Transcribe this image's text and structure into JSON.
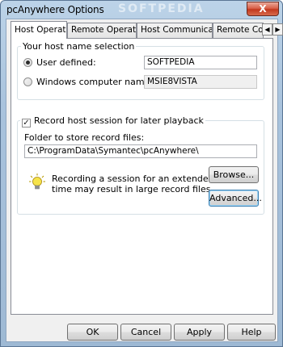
{
  "window": {
    "title": "pcAnywhere Options",
    "close_symbol": "X",
    "watermark": "SOFTPEDIA"
  },
  "tabs": [
    {
      "label": "Host Operation",
      "active": true
    },
    {
      "label": "Remote Operation",
      "active": false
    },
    {
      "label": "Host Communications",
      "active": false
    },
    {
      "label": "Remote Communications",
      "active": false
    }
  ],
  "tab_scroll": {
    "left_symbol": "◀",
    "right_symbol": "▶"
  },
  "host_name_group": {
    "legend": "Your host name selection",
    "user_defined": {
      "label": "User defined:",
      "checked": true,
      "value": "SOFTPEDIA"
    },
    "computer_name": {
      "label": "Windows computer name:",
      "checked": false,
      "value": "MSIE8VISTA"
    }
  },
  "record_group": {
    "checkbox_label": "Record host session for later playback",
    "checked": true,
    "check_symbol": "✓",
    "folder_label": "Folder to store record files:",
    "folder_value": "C:\\ProgramData\\Symantec\\pcAnywhere\\",
    "tip_text_line1": "Recording a session for an extended period of",
    "tip_text_line2": "time may result in large record files.",
    "browse_label": "Browse...",
    "advanced_label": "Advanced..."
  },
  "footer": {
    "ok_label": "OK",
    "cancel_label": "Cancel",
    "apply_label": "Apply",
    "help_label": "Help"
  },
  "colors": {
    "title_gradient": "#a9c3dd",
    "panel_bg": "#ffffff",
    "dialog_bg": "#f0f0f0",
    "bulb_yellow": "#f6e34a"
  }
}
